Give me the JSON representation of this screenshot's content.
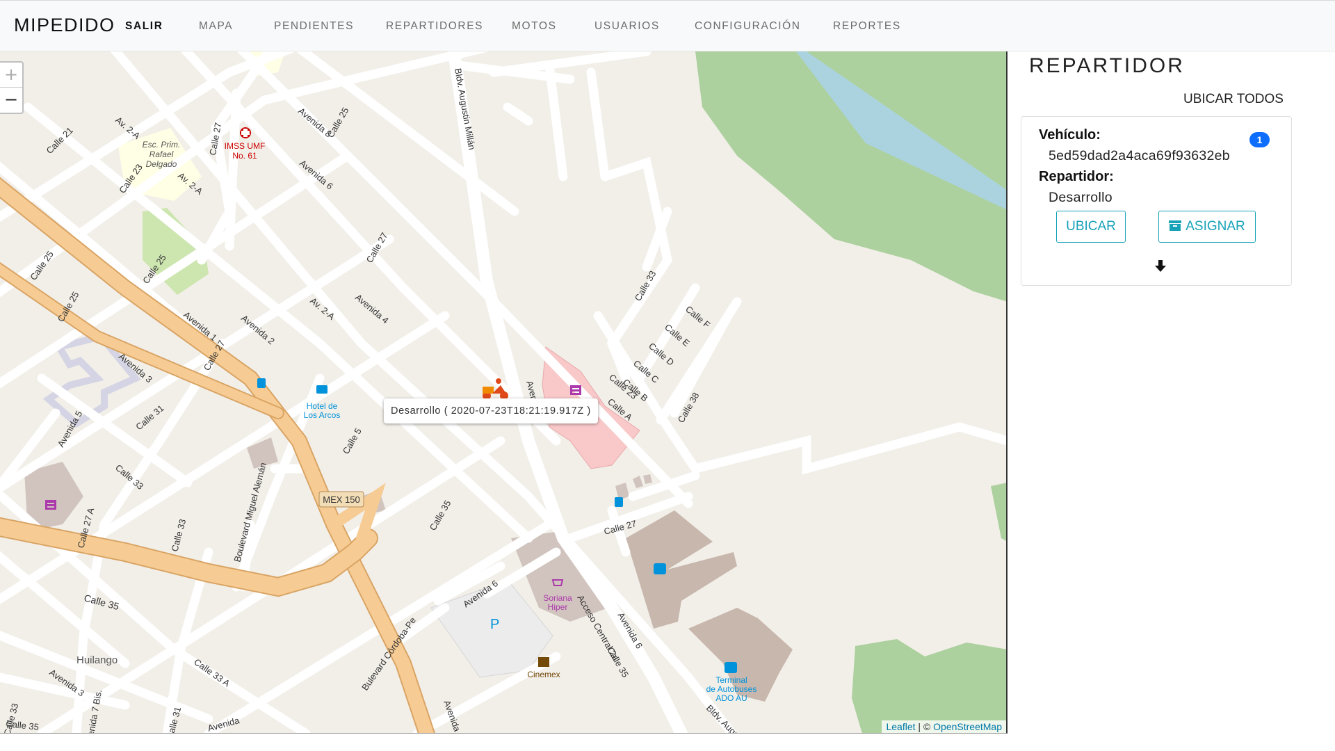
{
  "navbar": {
    "brand": "MIPEDIDO",
    "items": [
      {
        "label": "SALIR",
        "active": true
      },
      {
        "label": "MAPA",
        "active": false
      },
      {
        "label": "PENDIENTES",
        "active": false
      },
      {
        "label": "REPARTIDORES",
        "active": false
      },
      {
        "label": "MOTOS",
        "active": false
      },
      {
        "label": "USUARIOS",
        "active": false
      },
      {
        "label": "CONFIGURACIÓN",
        "active": false
      },
      {
        "label": "REPORTES",
        "active": false
      }
    ]
  },
  "map": {
    "zoom_in": "+",
    "zoom_out": "−",
    "popup": "Desarrollo ( 2020-07-23T18:21:19.917Z )",
    "attribution": {
      "leaflet": "Leaflet",
      "separator": " | © ",
      "osm": "OpenStreetMap"
    },
    "labels": {
      "streets": [
        "Calle 21",
        "Av. 2-A",
        "Calle 27",
        "Calle 25",
        "Avenida 8",
        "Bldv. Augustin Millán",
        "Calle 23",
        "Avenida 6",
        "Av. 2-A",
        "Calle 27",
        "Calle 25",
        "Avenida 1",
        "Avenida 2",
        "Av. 2-A",
        "Avenida 4",
        "Calle 33",
        "Calle F",
        "Calle E",
        "Calle D",
        "Calle C",
        "Calle B",
        "Calle A",
        "Calle 38",
        "Avenida 3",
        "Calle 27",
        "Calle 31",
        "Calle 5",
        "Avenida 5",
        "Calle 33",
        "Calle 35",
        "Calle 27",
        "Calle 27 A",
        "Calle 33",
        "Boulevard Miguel Alemán",
        "Calle 35",
        "Avenida 6",
        "Acceso Central 2a",
        "Avenida 6",
        "Calle 35",
        "Bulevard Córdoba-Pe",
        "Avenida 5",
        "Avenida 3",
        "Calle 33 A",
        "Calle 31",
        "Calle 33",
        "Avenida 7 Bis.",
        "Calle 35",
        "Avenida",
        "Bldv. Augustin Millán",
        "Avenida 6",
        "Calle 23",
        "Calle 25"
      ],
      "pois": {
        "imss": [
          "IMSS UMF",
          "No. 61"
        ],
        "school": [
          "Esc. Prim.",
          "Rafael",
          "Delgado"
        ],
        "hotel": [
          "Hotel de",
          "Los Arcos"
        ],
        "highway": "MEX 150",
        "soriana": [
          "Soriana",
          "Hiper"
        ],
        "cinemex": "Cinemex",
        "terminal": [
          "Terminal",
          "de Autobuses",
          "ADO AU"
        ],
        "huilango": "Huilango",
        "parking": "P"
      }
    }
  },
  "panel": {
    "title": "REPARTIDOR",
    "locate_all": "UBICAR TODOS",
    "card": {
      "vehicle_label": "Vehículo:",
      "vehicle_value": "5ed59dad2a4aca69f93632eb",
      "badge": "1",
      "driver_label": "Repartidor:",
      "driver_value": "Desarrollo",
      "locate_button": "UBICAR",
      "assign_button": "ASIGNAR"
    }
  },
  "icons": {
    "zoom": [
      "plus-icon",
      "minus-icon"
    ],
    "marker": "delivery-scooter-icon",
    "assign": "archive-box-icon",
    "expand": "arrow-down-icon"
  },
  "colors": {
    "map_background": "#f2efe9",
    "primary_road": "#f6cc94",
    "park": "#add19e",
    "accent_teal": "#17a2b8",
    "badge_blue": "#0d6efd"
  }
}
